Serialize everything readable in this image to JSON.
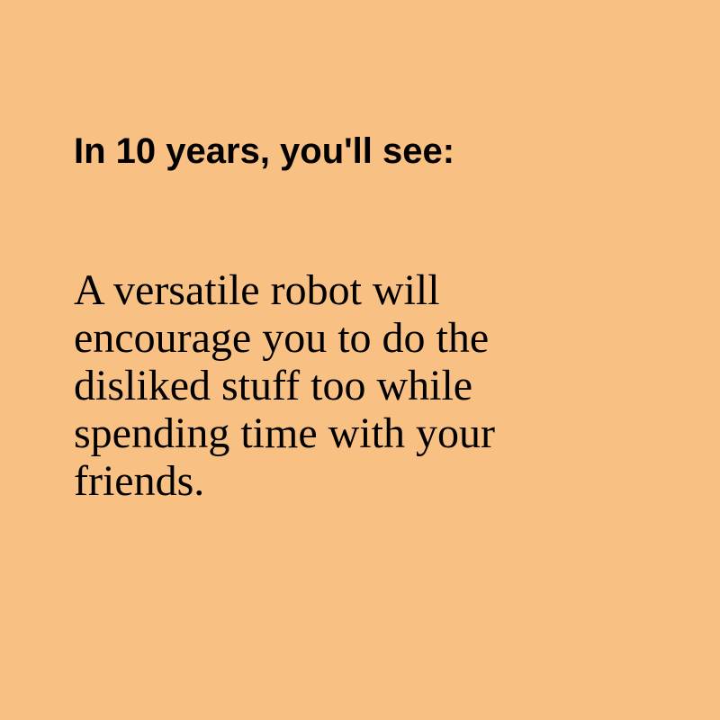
{
  "card": {
    "background": "#f8c083",
    "text_color": "#000000",
    "heading": "In 10 years, you'll see:",
    "body": "A versatile robot will encourage you to do the disliked stuff too while spending time with your friends."
  }
}
